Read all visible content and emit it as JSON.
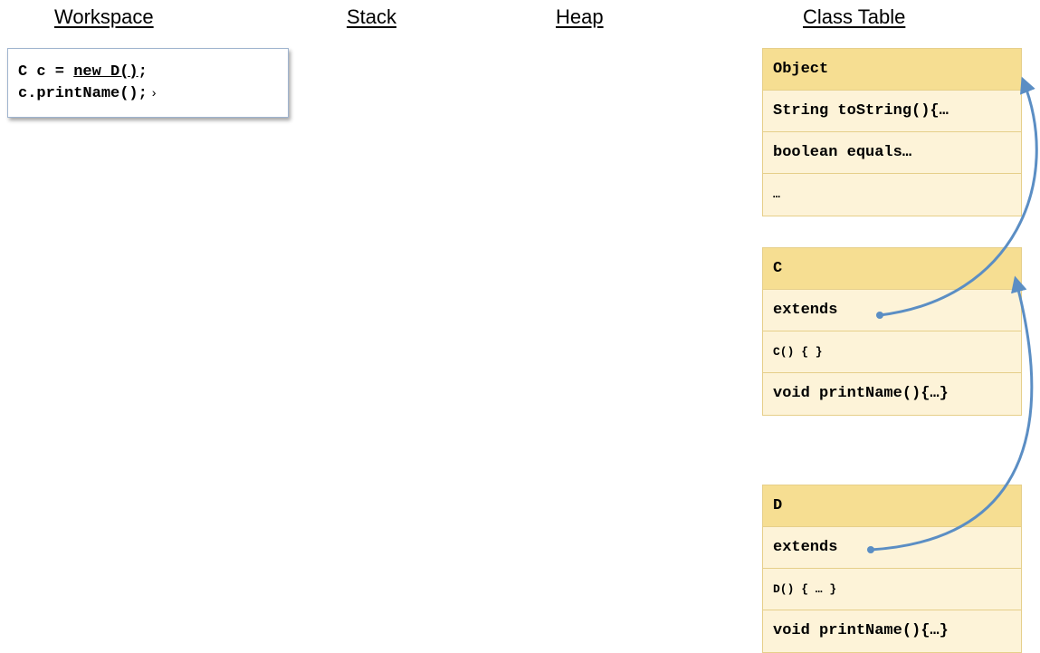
{
  "headings": {
    "workspace": "Workspace",
    "stack": "Stack",
    "heap": "Heap",
    "class_table": "Class Table"
  },
  "workspace": {
    "line1_prefix": "C c = ",
    "line1_underlined": "new D()",
    "line1_suffix": ";",
    "line2": "c.printName();",
    "cursor": "›"
  },
  "class_table": {
    "object": {
      "name": "Object",
      "rows": [
        "String toString(){…",
        "boolean equals…",
        "…"
      ]
    },
    "c": {
      "name": "C",
      "rows": [
        "extends",
        "C() { }",
        "void printName(){…}"
      ]
    },
    "d": {
      "name": "D",
      "rows": [
        "extends",
        "D() { … }",
        "void printName(){…}"
      ]
    }
  },
  "colors": {
    "header_fill": "#f6de92",
    "row_fill": "#fdf3d8",
    "border": "#e6cf8a",
    "arrow": "#5b8ec4"
  }
}
